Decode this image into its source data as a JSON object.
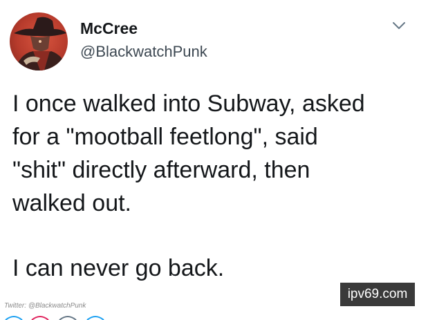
{
  "tweet": {
    "display_name": "McCree",
    "handle": "@BlackwatchPunk",
    "text_lines": [
      "I once walked into Subway, asked",
      "for a \"mootball feetlong\", said",
      "\"shit\" directly afterward, then",
      "walked out."
    ],
    "text_final": "I can never go back.",
    "menu_icon": "chevron-down-icon",
    "avatar_icon": "cowboy-hat-avatar"
  },
  "credit": "Twitter: @BlackwatchPunk",
  "watermark": "ipv69.com",
  "colors": {
    "background": "#ffffff",
    "text": "#14171a",
    "handle": "#3d4852",
    "avatar_bg": "#c4452f",
    "watermark_bg": "#3a3a3a",
    "action_icon_red": "#e0245e",
    "action_icon_blue": "#1da1f2"
  }
}
